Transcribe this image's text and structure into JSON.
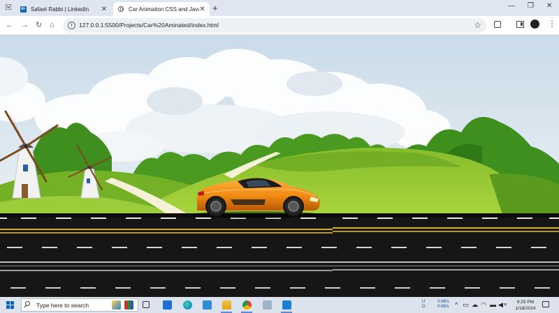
{
  "browser": {
    "tabs": [
      {
        "favicon": "linkedin-icon",
        "title": "Safaet Rabbi | LinkedIn",
        "active": false
      },
      {
        "favicon": "globe-icon",
        "title": "Car Animation CSS and JavaSc",
        "active": true
      }
    ],
    "new_tab_symbol": "+",
    "window_controls": {
      "minimize": "—",
      "restore": "❐",
      "close": "✕"
    },
    "address_bar": {
      "url": "127.0.0.1:5500/Projects/Car%20Aminated/index.html"
    },
    "nav": {
      "back": "←",
      "forward": "→",
      "reload": "↻",
      "home": "⌂"
    },
    "toolbar_icons": [
      "star-icon",
      "extensions-icon",
      "side-panel-icon",
      "profile-avatar",
      "menu-icon"
    ]
  },
  "scene": {
    "description_elements": [
      "sky",
      "clouds",
      "tree-line",
      "hills",
      "windmills",
      "path",
      "car",
      "road"
    ],
    "colors": {
      "sky_top": "#cddeec",
      "sky_bottom": "#e6eef4",
      "grass_light": "#9ccc33",
      "grass_dark": "#5a9a1e",
      "trees": "#3f8f1f",
      "road": "#1a1a1a",
      "lane_white": "#e8e8e8",
      "lane_yellow": "#d8b32a",
      "car_body": "#f08a12"
    }
  },
  "taskbar": {
    "search_placeholder": "Type here to search",
    "tray_net_labels": {
      "up_label": "U:",
      "down_label": "D:",
      "up_rate": "0 kB/s",
      "down_rate": "0 kB/s"
    },
    "time": "9:29 PM",
    "date": "1/18/2024",
    "app_icons": [
      "person-icon",
      "books-icon",
      "task-view-icon",
      "mail-icon",
      "edge-icon",
      "photos-icon",
      "file-explorer-icon",
      "chrome-icon",
      "picture-icon",
      "vscode-icon"
    ]
  }
}
